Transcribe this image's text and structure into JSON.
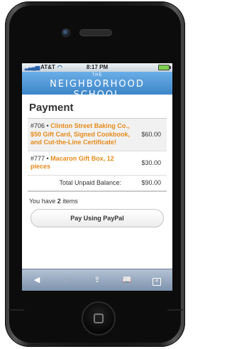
{
  "status_bar": {
    "carrier": "AT&T",
    "time": "8:17 PM"
  },
  "banner": {
    "the": "THE",
    "name": "NEIGHBORHOOD SCHOOL"
  },
  "page": {
    "title": "Payment"
  },
  "cart": {
    "items": [
      {
        "number": "#706",
        "separator": " • ",
        "name": "Clinton Street Baking Co., $50 Gift Card, Signed Cookbook, and Cut-the-Line Certificate!",
        "price": "$60.00"
      },
      {
        "number": "#777",
        "separator": " • ",
        "name": "Macaron Gift Box, 12 pieces",
        "price": "$30.00"
      }
    ],
    "total_label": "Total Unpaid Balance:",
    "total_value": "$90.00",
    "count_prefix": "You have ",
    "count": "2",
    "count_suffix": " items"
  },
  "pay_button": {
    "label": "Pay Using PayPal"
  },
  "toolbar": {
    "tabs_count": "4"
  },
  "icons": [
    "camera-icon",
    "back-icon",
    "forward-icon",
    "share-icon",
    "bookmarks-icon",
    "tabs-icon",
    "wifi-icon",
    "battery-icon"
  ],
  "colors": {
    "banner": "#4a94d6",
    "item_name": "#e58b1a",
    "toolbar": "#97a9c0"
  }
}
